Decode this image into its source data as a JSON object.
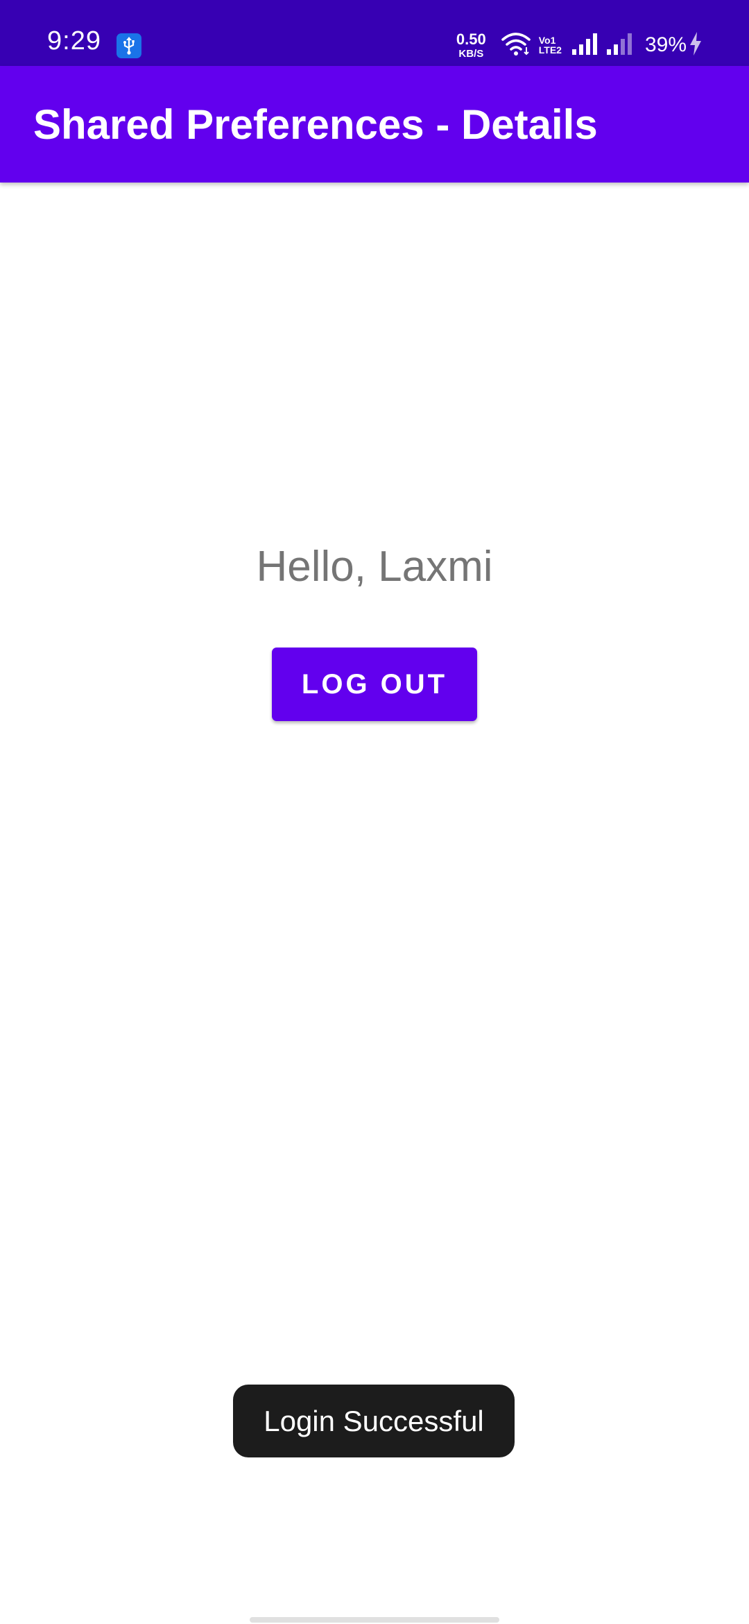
{
  "status_bar": {
    "time": "9:29",
    "usb_icon": "usb-icon",
    "net_speed_value": "0.50",
    "net_speed_unit": "KB/S",
    "volte_top": "Vo",
    "volte_bottom": "LTE",
    "sim1": "1",
    "sim2": "2",
    "battery_percent": "39%",
    "colors": {
      "background": "#3700b3",
      "usb_badge": "#1a73e8"
    }
  },
  "app_bar": {
    "title": "Shared Preferences - Details",
    "color": "#6200ee"
  },
  "main": {
    "greeting": "Hello, Laxmi",
    "logout_label": "LOG OUT",
    "button_color": "#6200ee"
  },
  "toast": {
    "message": "Login Successful"
  }
}
